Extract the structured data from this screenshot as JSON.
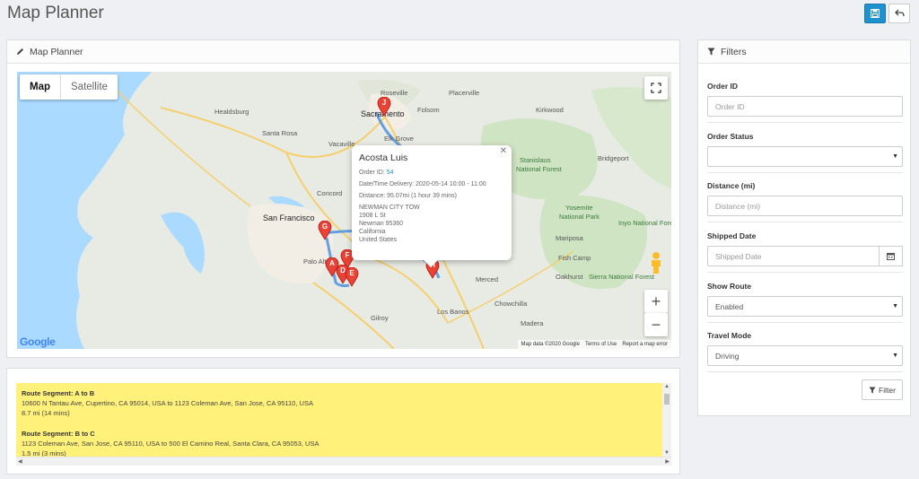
{
  "page": {
    "title": "Map Planner"
  },
  "map_panel": {
    "title": "Map Planner",
    "map_type": {
      "map_label": "Map",
      "satellite_label": "Satellite"
    },
    "labels": [
      "Roseville",
      "Placerville",
      "Healdsburg",
      "Folsom",
      "Sacramento",
      "Kirkwood",
      "Santa Rosa",
      "Vacaville",
      "Elk Grove",
      "Stanislaus",
      "National Forest",
      "Bridgeport",
      "Concord",
      "San Francisco",
      "Yosemite",
      "National Park",
      "Mariposa",
      "Inyo National Forest",
      "Palo Alto",
      "Fish Camp",
      "Merced",
      "Oakhurst",
      "Sierra National Forest",
      "Chowchilla",
      "Gilroy",
      "Los Banos",
      "Madera"
    ],
    "markers": [
      "A",
      "D",
      "E",
      "F",
      "G",
      "H",
      "J"
    ],
    "footer": {
      "map_data": "Map data ©2020 Google",
      "terms": "Terms of Use",
      "report": "Report a map error"
    },
    "google": "Google",
    "info_window": {
      "name": "Acosta Luis",
      "order_id_label": "Order ID:",
      "order_id": "54",
      "delivery": "Date/Time Delivery: 2020-05-14 10:00 - 11:00",
      "distance": "Distance: 95.07mi (1 hour 39 mins)",
      "address": [
        "NEWMAN CITY TOW",
        "1908 L St",
        "Newman 95360",
        "California",
        "United States"
      ]
    }
  },
  "routes": [
    {
      "title": "Route Segment: A to B",
      "path": "10600 N Tantau Ave, Cupertino, CA 95014, USA to 1123 Coleman Ave, San Jose, CA 95110, USA",
      "info": "8.7 mi (14 mins)"
    },
    {
      "title": "Route Segment: B to C",
      "path": "1123 Coleman Ave, San Jose, CA 95110, USA to 500 El Camino Real, Santa Clara, CA 95053, USA",
      "info": "1.5 mi (3 mins)"
    }
  ],
  "filters": {
    "title": "Filters",
    "order_id": {
      "label": "Order ID",
      "placeholder": "Order ID"
    },
    "order_status": {
      "label": "Order Status",
      "value": ""
    },
    "distance": {
      "label": "Distance (mi)",
      "placeholder": "Distance (mi)"
    },
    "shipped_date": {
      "label": "Shipped Date",
      "placeholder": "Shipped Date"
    },
    "show_route": {
      "label": "Show Route",
      "value": "Enabled"
    },
    "travel_mode": {
      "label": "Travel Mode",
      "value": "Driving"
    },
    "button": "Filter"
  },
  "colors": {
    "primary": "#1e91cf",
    "marker": "#ea4335",
    "route": "#4a90e2",
    "route_bg": "#fff17a"
  }
}
